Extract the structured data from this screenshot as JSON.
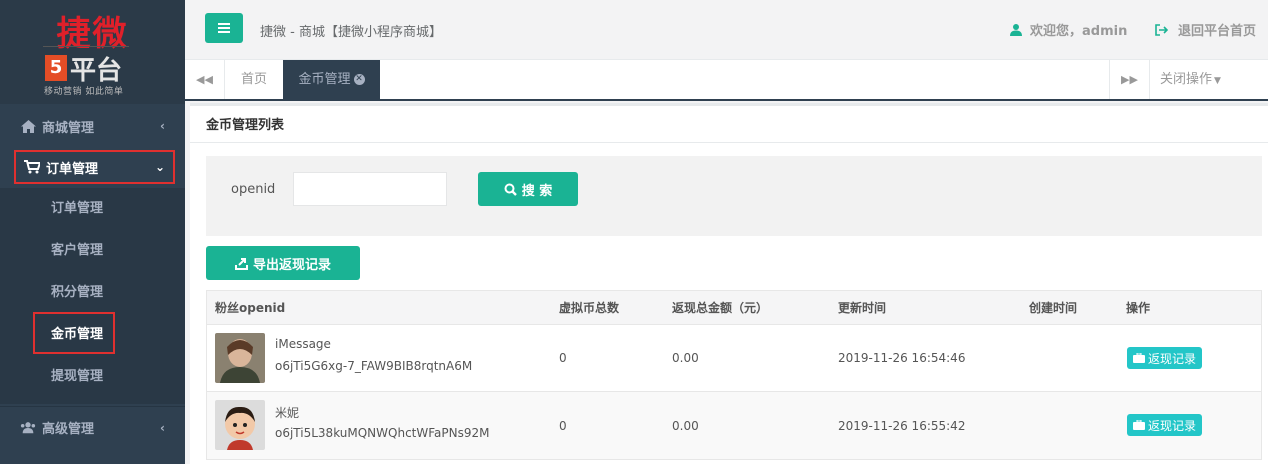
{
  "logo": {
    "brand": "捷微",
    "platform": "平台",
    "h5": "5",
    "slogan": "移动营销 如此简单"
  },
  "sidebar": {
    "mall": {
      "label": "商城管理",
      "arrow": "‹"
    },
    "order": {
      "label": "订单管理",
      "arrow": "⌄"
    },
    "submenu": [
      "订单管理",
      "客户管理",
      "积分管理",
      "金币管理",
      "提现管理"
    ],
    "advanced": {
      "label": "高级管理",
      "arrow": "‹"
    }
  },
  "header": {
    "breadcrumb": "捷微 - 商城【捷微小程序商城】",
    "welcome": "欢迎您，admin",
    "logout": "退回平台首页"
  },
  "tabs": {
    "home": "首页",
    "active": "金币管理",
    "close_ops": "关闭操作"
  },
  "panel": {
    "title": "金币管理列表"
  },
  "search": {
    "label": "openid",
    "value": "",
    "button": "搜 索"
  },
  "export": {
    "label": "导出返现记录"
  },
  "table": {
    "headers": [
      "粉丝openid",
      "虚拟币总数",
      "返现总金额（元）",
      "更新时间",
      "创建时间",
      "操作"
    ],
    "rows": [
      {
        "name": "iMessage",
        "openid": "o6jTi5G6xg-7_FAW9BIB8rqtnA6M",
        "coins": "0",
        "amount": "0.00",
        "updated": "2019-11-26 16:54:46",
        "created": "",
        "action": "返现记录"
      },
      {
        "name": "米妮",
        "openid": "o6jTi5L38kuMQNWQhctWFaPNs92M",
        "coins": "0",
        "amount": "0.00",
        "updated": "2019-11-26 16:55:42",
        "created": "",
        "action": "返现记录"
      }
    ]
  },
  "colors": {
    "accent": "#1ab394",
    "sidebar": "#2f4050",
    "highlight_box": "#e0302f",
    "info_button": "#23c6c8"
  }
}
